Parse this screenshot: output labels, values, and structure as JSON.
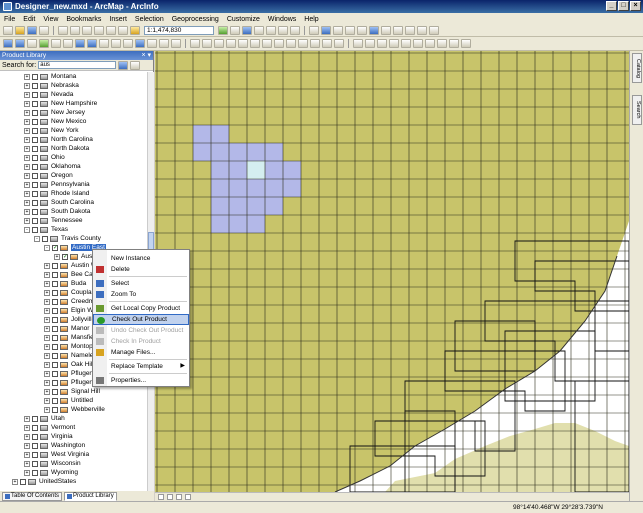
{
  "window": {
    "title": "Designer_new.mxd - ArcMap - ArcInfo"
  },
  "menu": [
    "File",
    "Edit",
    "View",
    "Bookmarks",
    "Insert",
    "Selection",
    "Geoprocessing",
    "Customize",
    "Windows",
    "Help"
  ],
  "toolbar": {
    "scale": "1:1,474,830"
  },
  "panel": {
    "title": "Product Library",
    "search_label": "Search for:",
    "search_value": "aus"
  },
  "tree": [
    {
      "label": "Montana",
      "indent": 1,
      "pm": "+"
    },
    {
      "label": "Nebraska",
      "indent": 1,
      "pm": "+"
    },
    {
      "label": "Nevada",
      "indent": 1,
      "pm": "+"
    },
    {
      "label": "New Hampshire",
      "indent": 1,
      "pm": "+"
    },
    {
      "label": "New Jersey",
      "indent": 1,
      "pm": "+"
    },
    {
      "label": "New Mexico",
      "indent": 1,
      "pm": "+"
    },
    {
      "label": "New York",
      "indent": 1,
      "pm": "+"
    },
    {
      "label": "North Carolina",
      "indent": 1,
      "pm": "+"
    },
    {
      "label": "North Dakota",
      "indent": 1,
      "pm": "+"
    },
    {
      "label": "Ohio",
      "indent": 1,
      "pm": "+"
    },
    {
      "label": "Oklahoma",
      "indent": 1,
      "pm": "+"
    },
    {
      "label": "Oregon",
      "indent": 1,
      "pm": "+"
    },
    {
      "label": "Pennsylvania",
      "indent": 1,
      "pm": "+"
    },
    {
      "label": "Rhode Island",
      "indent": 1,
      "pm": "+"
    },
    {
      "label": "South Carolina",
      "indent": 1,
      "pm": "+"
    },
    {
      "label": "South Dakota",
      "indent": 1,
      "pm": "+"
    },
    {
      "label": "Tennessee",
      "indent": 1,
      "pm": "+"
    },
    {
      "label": "Texas",
      "indent": 1,
      "pm": "-"
    },
    {
      "label": "Travis County",
      "indent": 2,
      "pm": "-"
    },
    {
      "label": "Austin East",
      "indent": 3,
      "pm": "-",
      "sel": true,
      "check": true
    },
    {
      "label": "Austin",
      "indent": 4,
      "pm": "+",
      "check": true
    },
    {
      "label": "Austin West",
      "indent": 3,
      "pm": "+"
    },
    {
      "label": "Bee Cave",
      "indent": 3,
      "pm": "+"
    },
    {
      "label": "Buda",
      "indent": 3,
      "pm": "+"
    },
    {
      "label": "Coupland",
      "indent": 3,
      "pm": "+"
    },
    {
      "label": "Creedmoor",
      "indent": 3,
      "pm": "+"
    },
    {
      "label": "Elgin West",
      "indent": 3,
      "pm": "+"
    },
    {
      "label": "Jollyville",
      "indent": 3,
      "pm": "+"
    },
    {
      "label": "Manor",
      "indent": 3,
      "pm": "+"
    },
    {
      "label": "Mansfield Dam",
      "indent": 3,
      "pm": "+"
    },
    {
      "label": "Montopolis",
      "indent": 3,
      "pm": "+"
    },
    {
      "label": "Nameless",
      "indent": 3,
      "pm": "+"
    },
    {
      "label": "Oak Hill",
      "indent": 3,
      "pm": "+"
    },
    {
      "label": "Pflugerville East",
      "indent": 3,
      "pm": "+"
    },
    {
      "label": "Pflugerville West",
      "indent": 3,
      "pm": "+"
    },
    {
      "label": "Signal Hill",
      "indent": 3,
      "pm": "+"
    },
    {
      "label": "Untitled",
      "indent": 3,
      "pm": "+"
    },
    {
      "label": "Webberville",
      "indent": 3,
      "pm": "+"
    },
    {
      "label": "Utah",
      "indent": 1,
      "pm": "+"
    },
    {
      "label": "Vermont",
      "indent": 1,
      "pm": "+"
    },
    {
      "label": "Virginia",
      "indent": 1,
      "pm": "+"
    },
    {
      "label": "Washington",
      "indent": 1,
      "pm": "+"
    },
    {
      "label": "West Virginia",
      "indent": 1,
      "pm": "+"
    },
    {
      "label": "Wisconsin",
      "indent": 1,
      "pm": "+"
    },
    {
      "label": "Wyoming",
      "indent": 1,
      "pm": "+"
    },
    {
      "label": "UnitedStates",
      "indent": 0,
      "pm": "+"
    }
  ],
  "context_menu": [
    {
      "label": "New Instance",
      "state": "normal"
    },
    {
      "label": "Delete",
      "state": "normal",
      "icon": "delete-icon"
    },
    {
      "sep": true
    },
    {
      "label": "Select",
      "state": "normal",
      "icon": "select-icon"
    },
    {
      "label": "Zoom To",
      "state": "normal",
      "icon": "zoom-icon"
    },
    {
      "sep": true
    },
    {
      "label": "Get Local Copy Product",
      "state": "normal",
      "icon": "copy-icon"
    },
    {
      "label": "Check Out Product",
      "state": "highlighted",
      "icon": "checkout-icon"
    },
    {
      "label": "Undo Check Out Product",
      "state": "disabled",
      "icon": "undo-icon"
    },
    {
      "label": "Check In Product",
      "state": "disabled",
      "icon": "checkin-icon"
    },
    {
      "label": "Manage Files...",
      "state": "normal",
      "icon": "files-icon"
    },
    {
      "sep": true
    },
    {
      "label": "Replace Template",
      "state": "normal",
      "submenu": true
    },
    {
      "sep": true
    },
    {
      "label": "Properties...",
      "state": "normal",
      "icon": "properties-icon"
    }
  ],
  "panel_tabs": [
    "Table Of Contents",
    "Product Library"
  ],
  "right_tabs": [
    "Catalog",
    "Search"
  ],
  "status": {
    "coords": "98°14'40.468\"W  29°28'3.739\"N"
  },
  "colors": {
    "land": "#c8c46a",
    "grid": "#2a2a1a",
    "selected_tiles": "#b3b8e8",
    "selected_center": "#d4eef0",
    "water": "#ffffff"
  }
}
